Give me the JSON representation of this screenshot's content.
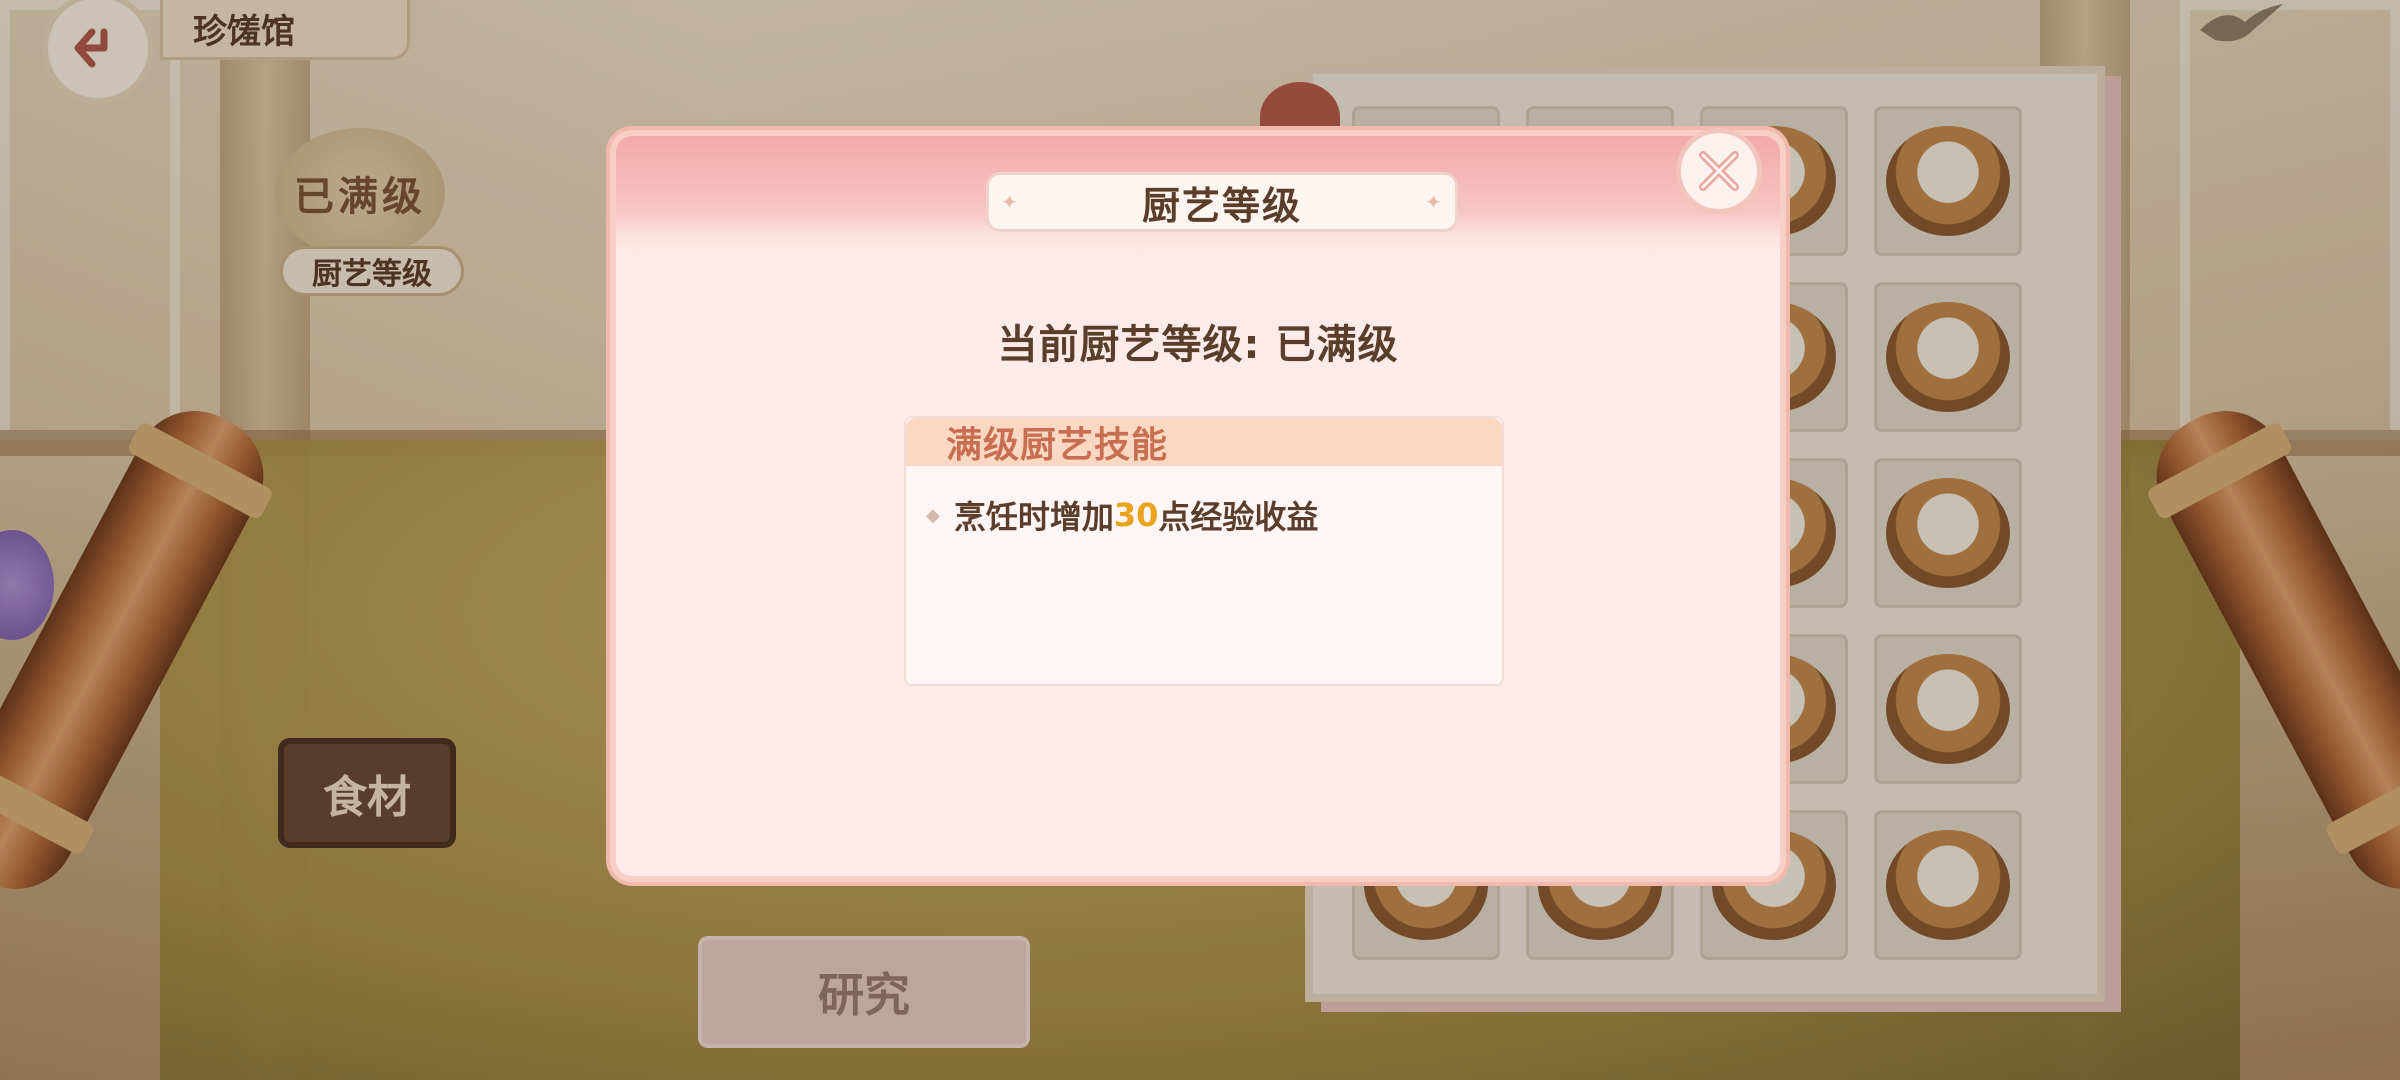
{
  "header": {
    "title": "珍馐馆"
  },
  "left_panel": {
    "level_seal_text": "已满级",
    "level_label": "厨艺等级",
    "ingredient_button": "食材",
    "research_button": "研究"
  },
  "modal": {
    "title": "厨艺等级",
    "current_level_label": "当前厨艺等级:",
    "current_level_value": "已满级",
    "skill_section_title": "满级厨艺技能",
    "skill_prefix": "烹饪时增加",
    "skill_value": "30",
    "skill_suffix": "点经验收益"
  },
  "colors": {
    "highlight": "#e9a31c",
    "modal_header": "#f3a9ab",
    "text_main": "#5a3d2b",
    "skill_title": "#c86f52"
  },
  "icons": [
    "back-arrow-icon",
    "close-icon",
    "bird-icon"
  ]
}
